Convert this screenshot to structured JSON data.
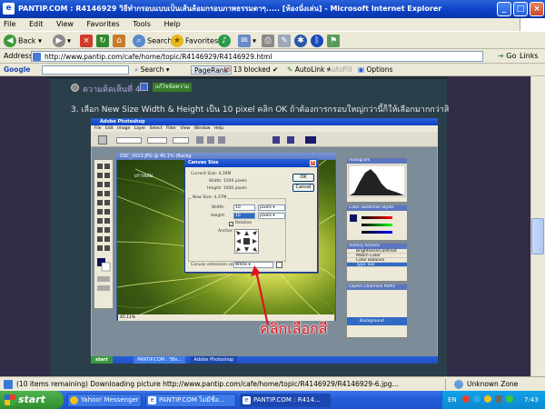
{
  "window": {
    "title": "PANTIP.COM : R4146929 วิธีทำกรอบแบบเป็นเส้นล้อมกรอบภาพธรรมดาๆ..... [ห้องนั่งเล่น] - Microsoft Internet Explorer"
  },
  "menubar": {
    "items": [
      "File",
      "Edit",
      "View",
      "Favorites",
      "Tools",
      "Help"
    ]
  },
  "toolbar": {
    "back": "Back",
    "search": "Search",
    "favorites": "Favorites"
  },
  "address": {
    "label": "Address",
    "url": "http://www.pantip.com/cafe/home/topic/R4146929/R4146929.html",
    "go": "Go",
    "links": "Links"
  },
  "googlebar": {
    "logo": "Google",
    "search": "Search",
    "pagerank": "PageRank",
    "blocked": "13 blocked",
    "autolink": "AutoLink",
    "autofill": "AutoFill",
    "options": "Options"
  },
  "post": {
    "comment_header": "ความคิดเห็นที่ 4",
    "edit_badge": "แก้ไขข้อความ",
    "instruction": "3. เลือก New Size Width & Height เป็น 10 pixel คลิก OK ถ้าต้องการกรอบใหญ่กว่านี้ก็ให้เลือกมากกว่าสิบ"
  },
  "photoshop": {
    "app_title": "Adobe Photoshop",
    "menu": [
      "File",
      "Edit",
      "Image",
      "Layer",
      "Select",
      "Filter",
      "View",
      "Window",
      "Help"
    ],
    "doc_title": "DSC_0013.JPG @ 45.1% (Backg",
    "watermark": "เกาหล่ม",
    "zoom": "45.11%",
    "taskbar_start": "start",
    "taskbar_items": [
      "PANTIP.COM : วิธีท...",
      "Adobe Photoshop"
    ]
  },
  "dialog": {
    "title": "Canvas Size",
    "current_size_label": "Current Size: 4.30M",
    "current_width": "Width: 1504 pixels",
    "current_height": "Height: 1000 pixels",
    "new_size_label": "New Size: 4.37M",
    "width_label": "Width:",
    "width_value": "10",
    "height_label": "Height:",
    "height_value": "10",
    "unit": "pixels",
    "relative": "Relative",
    "anchor": "Anchor:",
    "ok": "OK",
    "cancel": "Cancel",
    "ext_color_label": "Canvas extension color:",
    "ext_color_value": "White"
  },
  "panels": {
    "histogram": "Histogram",
    "color": "Color",
    "swatches": "Swatches",
    "styles": "Styles",
    "history": "History",
    "actions": "Actions",
    "history_items": [
      "Brightness/Contrast",
      "Match Color",
      "Color Balance",
      "Type Tool"
    ],
    "layers": "Layers",
    "channels": "Channels",
    "paths": "Paths",
    "layer_items": [
      "Background"
    ]
  },
  "annotation": {
    "text": "คลิกเลือกสี",
    "color": "#e0141e"
  },
  "statusbar": {
    "text": "(10 items remaining) Downloading picture http://www.pantip.com/cafe/home/topic/R4146929/R4146929-6.jpg...",
    "zone": "Unknown Zone"
  },
  "taskbar": {
    "start": "start",
    "items": [
      "Yahoo! Messenger wi...",
      "PANTIP.COM ไม่มีชื่อ...",
      "PANTIP.COM : R414..."
    ],
    "lang": "EN",
    "time": "7:43"
  },
  "colors": {
    "xp_blue": "#0b3fc4",
    "page_bg": "#322c49",
    "post_bg": "#2b3f4b"
  }
}
